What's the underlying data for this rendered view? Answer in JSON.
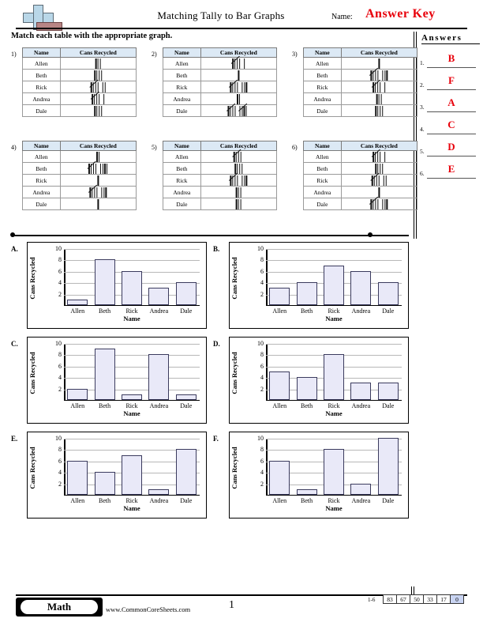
{
  "header": {
    "title": "Matching Tally to Bar Graphs",
    "name_label": "Name:",
    "answer_key": "Answer Key",
    "logo_colors": {
      "plus": "#b9d7e8",
      "bar": "#b88585"
    }
  },
  "instructions": "Match each table with the appropriate graph.",
  "answers_panel": {
    "title": "Answers",
    "items": [
      {
        "num": "1.",
        "value": "B"
      },
      {
        "num": "2.",
        "value": "F"
      },
      {
        "num": "3.",
        "value": "A"
      },
      {
        "num": "4.",
        "value": "C"
      },
      {
        "num": "5.",
        "value": "D"
      },
      {
        "num": "6.",
        "value": "E"
      }
    ],
    "answer_color": "#e8000b"
  },
  "tables": {
    "columns": [
      "Name",
      "Cans Recycled"
    ],
    "names": [
      "Allen",
      "Beth",
      "Rick",
      "Andrea",
      "Dale"
    ],
    "items": [
      {
        "num": "1)",
        "counts": [
          3,
          4,
          7,
          6,
          4
        ]
      },
      {
        "num": "2)",
        "counts": [
          6,
          1,
          8,
          2,
          10
        ]
      },
      {
        "num": "3)",
        "counts": [
          1,
          8,
          6,
          3,
          4
        ]
      },
      {
        "num": "4)",
        "counts": [
          2,
          9,
          1,
          8,
          1
        ]
      },
      {
        "num": "5)",
        "counts": [
          5,
          4,
          8,
          3,
          3
        ]
      },
      {
        "num": "6)",
        "counts": [
          6,
          4,
          7,
          1,
          8
        ]
      }
    ]
  },
  "chart_data": [
    {
      "type": "bar",
      "letter": "A.",
      "categories": [
        "Allen",
        "Beth",
        "Rick",
        "Andrea",
        "Dale"
      ],
      "values": [
        1,
        8,
        6,
        3,
        4
      ],
      "title": "",
      "xlabel": "Name",
      "ylabel": "Cans Recycled",
      "ylim": [
        0,
        10
      ],
      "yticks": [
        2,
        4,
        6,
        8,
        10
      ],
      "grid": true,
      "legend": "none"
    },
    {
      "type": "bar",
      "letter": "B.",
      "categories": [
        "Allen",
        "Beth",
        "Rick",
        "Andrea",
        "Dale"
      ],
      "values": [
        3,
        4,
        7,
        6,
        4
      ],
      "title": "",
      "xlabel": "Name",
      "ylabel": "Cans Recycled",
      "ylim": [
        0,
        10
      ],
      "yticks": [
        2,
        4,
        6,
        8,
        10
      ],
      "grid": true,
      "legend": "none"
    },
    {
      "type": "bar",
      "letter": "C.",
      "categories": [
        "Allen",
        "Beth",
        "Rick",
        "Andrea",
        "Dale"
      ],
      "values": [
        2,
        9,
        1,
        8,
        1
      ],
      "title": "",
      "xlabel": "Name",
      "ylabel": "Cans Recycled",
      "ylim": [
        0,
        10
      ],
      "yticks": [
        2,
        4,
        6,
        8,
        10
      ],
      "grid": true,
      "legend": "none"
    },
    {
      "type": "bar",
      "letter": "D.",
      "categories": [
        "Allen",
        "Beth",
        "Rick",
        "Andrea",
        "Dale"
      ],
      "values": [
        5,
        4,
        8,
        3,
        3
      ],
      "title": "",
      "xlabel": "Name",
      "ylabel": "Cans Recycled",
      "ylim": [
        0,
        10
      ],
      "yticks": [
        2,
        4,
        6,
        8,
        10
      ],
      "grid": true,
      "legend": "none"
    },
    {
      "type": "bar",
      "letter": "E.",
      "categories": [
        "Allen",
        "Beth",
        "Rick",
        "Andrea",
        "Dale"
      ],
      "values": [
        6,
        4,
        7,
        1,
        8
      ],
      "title": "",
      "xlabel": "Name",
      "ylabel": "Cans Recycled",
      "ylim": [
        0,
        10
      ],
      "yticks": [
        2,
        4,
        6,
        8,
        10
      ],
      "grid": true,
      "legend": "none"
    },
    {
      "type": "bar",
      "letter": "F.",
      "categories": [
        "Allen",
        "Beth",
        "Rick",
        "Andrea",
        "Dale"
      ],
      "values": [
        6,
        1,
        8,
        2,
        10
      ],
      "title": "",
      "xlabel": "Name",
      "ylabel": "Cans Recycled",
      "ylim": [
        0,
        10
      ],
      "yticks": [
        2,
        4,
        6,
        8,
        10
      ],
      "grid": true,
      "legend": "none"
    }
  ],
  "footer": {
    "subject": "Math",
    "url": "www.CommonCoreSheets.com",
    "page_number": "1",
    "score_range": "1-6",
    "score_values": [
      "83",
      "67",
      "50",
      "33",
      "17",
      "0"
    ],
    "highlight_index": 5
  }
}
